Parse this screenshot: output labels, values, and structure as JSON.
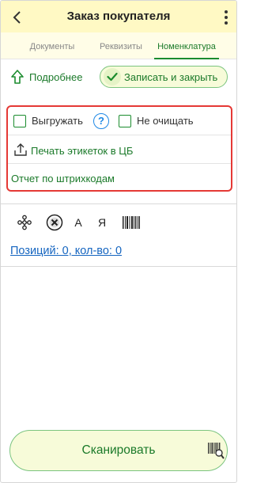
{
  "header": {
    "title": "Заказ покупателя"
  },
  "tabs": [
    {
      "label": "Документы",
      "active": false
    },
    {
      "label": "Реквизиты",
      "active": false
    },
    {
      "label": "Номенклатура",
      "active": true
    }
  ],
  "actions": {
    "more_label": "Подробнее",
    "save_close_label": "Записать и закрыть"
  },
  "options": {
    "export_label": "Выгружать",
    "export_checked": false,
    "no_clear_label": "Не очищать",
    "no_clear_checked": false,
    "help_symbol": "?",
    "print_labels_link": "Печать этикеток в ЦБ",
    "barcode_report_link": "Отчет по штрихкодам"
  },
  "toolbar": {
    "sort_asc_letter": "А",
    "sort_desc_letter": "Я"
  },
  "positions_summary": "Позиций: 0, кол-во: 0",
  "scan_label": "Сканировать",
  "colors": {
    "accent_green": "#1b7a2a",
    "header_bg": "#fff9c4",
    "highlight_border": "#e53935",
    "link_blue": "#1565c0",
    "help_blue": "#1e88e5"
  }
}
